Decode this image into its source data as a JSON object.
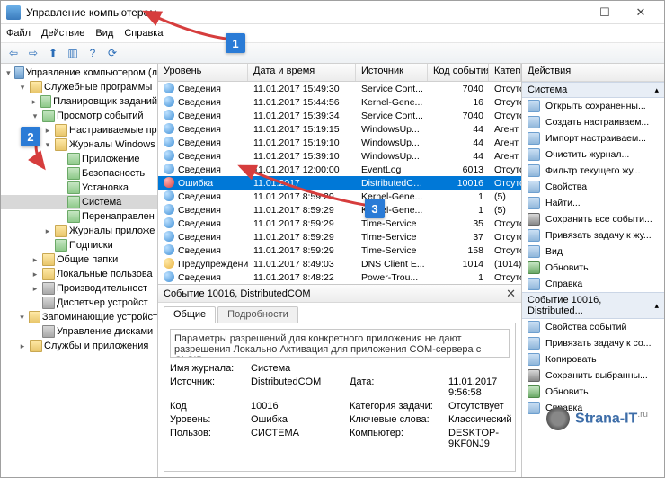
{
  "titlebar": {
    "title": "Управление компьютером"
  },
  "menubar": [
    "Файл",
    "Действие",
    "Вид",
    "Справка"
  ],
  "tree": {
    "root": "Управление компьютером (л",
    "items": [
      {
        "label": "Служебные программы",
        "depth": 1,
        "exp": "▾",
        "ico": "folder"
      },
      {
        "label": "Планировщик заданий",
        "depth": 2,
        "exp": "▸",
        "ico": "log"
      },
      {
        "label": "Просмотр событий",
        "depth": 2,
        "exp": "▾",
        "ico": "log"
      },
      {
        "label": "Настраиваемые пр",
        "depth": 3,
        "exp": "▸",
        "ico": "folder"
      },
      {
        "label": "Журналы Windows",
        "depth": 3,
        "exp": "▾",
        "ico": "folder"
      },
      {
        "label": "Приложение",
        "depth": 4,
        "exp": "",
        "ico": "log"
      },
      {
        "label": "Безопасность",
        "depth": 4,
        "exp": "",
        "ico": "log"
      },
      {
        "label": "Установка",
        "depth": 4,
        "exp": "",
        "ico": "log"
      },
      {
        "label": "Система",
        "depth": 4,
        "exp": "",
        "ico": "log",
        "sel": true
      },
      {
        "label": "Перенаправлен",
        "depth": 4,
        "exp": "",
        "ico": "log"
      },
      {
        "label": "Журналы приложе",
        "depth": 3,
        "exp": "▸",
        "ico": "folder"
      },
      {
        "label": "Подписки",
        "depth": 3,
        "exp": "",
        "ico": "log"
      },
      {
        "label": "Общие папки",
        "depth": 2,
        "exp": "▸",
        "ico": "folder"
      },
      {
        "label": "Локальные пользова",
        "depth": 2,
        "exp": "▸",
        "ico": "folder"
      },
      {
        "label": "Производительност",
        "depth": 2,
        "exp": "▸",
        "ico": "sys"
      },
      {
        "label": "Диспетчер устройст",
        "depth": 2,
        "exp": "",
        "ico": "sys"
      },
      {
        "label": "Запоминающие устройст",
        "depth": 1,
        "exp": "▾",
        "ico": "folder"
      },
      {
        "label": "Управление дисками",
        "depth": 2,
        "exp": "",
        "ico": "sys"
      },
      {
        "label": "Службы и приложения",
        "depth": 1,
        "exp": "▸",
        "ico": "folder"
      }
    ]
  },
  "grid": {
    "headers": {
      "level": "Уровень",
      "date": "Дата и время",
      "source": "Источник",
      "evt": "Код события",
      "cat": "Категория з..."
    },
    "rows": [
      {
        "lvl": "info",
        "level": "Сведения",
        "date": "11.01.2017 15:49:30",
        "src": "Service Cont...",
        "evt": "7040",
        "cat": "Отсутствует"
      },
      {
        "lvl": "info",
        "level": "Сведения",
        "date": "11.01.2017 15:44:56",
        "src": "Kernel-Gene...",
        "evt": "16",
        "cat": "Отсутствует"
      },
      {
        "lvl": "info",
        "level": "Сведения",
        "date": "11.01.2017 15:39:34",
        "src": "Service Cont...",
        "evt": "7040",
        "cat": "Отсутствует"
      },
      {
        "lvl": "info",
        "level": "Сведения",
        "date": "11.01.2017 15:19:15",
        "src": "WindowsUp...",
        "evt": "44",
        "cat": "Агент Центр..."
      },
      {
        "lvl": "info",
        "level": "Сведения",
        "date": "11.01.2017 15:19:10",
        "src": "WindowsUp...",
        "evt": "44",
        "cat": "Агент Центр..."
      },
      {
        "lvl": "info",
        "level": "Сведения",
        "date": "11.01.2017 15:39:10",
        "src": "WindowsUp...",
        "evt": "44",
        "cat": "Агент Центр..."
      },
      {
        "lvl": "info",
        "level": "Сведения",
        "date": "11.01.2017 12:00:00",
        "src": "EventLog",
        "evt": "6013",
        "cat": "Отсутствует"
      },
      {
        "lvl": "err",
        "level": "Ошибка",
        "date": "11.01.2017",
        "src": "DistributedC…",
        "evt": "10016",
        "cat": "Отсутствует",
        "sel": true
      },
      {
        "lvl": "info",
        "level": "Сведения",
        "date": "11.01.2017 8:59:29",
        "src": "Kernel-Gene...",
        "evt": "1",
        "cat": "(5)"
      },
      {
        "lvl": "info",
        "level": "Сведения",
        "date": "11.01.2017 8:59:29",
        "src": "Kernel-Gene...",
        "evt": "1",
        "cat": "(5)"
      },
      {
        "lvl": "info",
        "level": "Сведения",
        "date": "11.01.2017 8:59:29",
        "src": "Time-Service",
        "evt": "35",
        "cat": "Отсутствует"
      },
      {
        "lvl": "info",
        "level": "Сведения",
        "date": "11.01.2017 8:59:29",
        "src": "Time-Service",
        "evt": "37",
        "cat": "Отсутствует"
      },
      {
        "lvl": "info",
        "level": "Сведения",
        "date": "11.01.2017 8:59:29",
        "src": "Time-Service",
        "evt": "158",
        "cat": "Отсутствует"
      },
      {
        "lvl": "warn",
        "level": "Предупреждение",
        "date": "11.01.2017 8:49:03",
        "src": "DNS Client E...",
        "evt": "1014",
        "cat": "(1014)"
      },
      {
        "lvl": "info",
        "level": "Сведения",
        "date": "11.01.2017 8:48:22",
        "src": "Power-Trou...",
        "evt": "1",
        "cat": "Отсутствует"
      }
    ]
  },
  "detail": {
    "title": "Событие 10016, DistributedCOM",
    "tabs": {
      "general": "Общие",
      "details": "Подробности"
    },
    "message": "Параметры разрешений для конкретного приложения не дают разрешения Локально Активация для приложения COM-сервера с CLSID",
    "log_name_k": "Имя журнала:",
    "log_name_v": "Система",
    "source_k": "Источник:",
    "source_v": "DistributedCOM",
    "date_k": "Дата:",
    "date_v": "11.01.2017 9:56:58",
    "code_k": "Код",
    "code_v": "10016",
    "cat_k": "Категория задачи:",
    "cat_v": "Отсутствует",
    "level_k": "Уровень:",
    "level_v": "Ошибка",
    "keywords_k": "Ключевые слова:",
    "keywords_v": "Классический",
    "user_k": "Пользов:",
    "user_v": "СИСТЕМА",
    "computer_k": "Компьютер:",
    "computer_v": "DESKTOP-9KF0NJ9"
  },
  "actions": {
    "header": "Действия",
    "section1": "Система",
    "items1": [
      "Открыть сохраненны...",
      "Создать настраиваем...",
      "Импорт настраиваем...",
      "Очистить журнал...",
      "Фильтр текущего жу...",
      "Свойства",
      "Найти...",
      "Сохранить все событи...",
      "Привязать задачу к жу...",
      "Вид",
      "Обновить",
      "Справка"
    ],
    "section2": "Событие 10016, Distributed...",
    "items2": [
      "Свойства событий",
      "Привязать задачу к со...",
      "Копировать",
      "Сохранить выбранны...",
      "Обновить",
      "Справка"
    ]
  },
  "badges": {
    "b1": "1",
    "b2": "2",
    "b3": "3"
  },
  "watermark": {
    "text": "Strana-IT",
    "suffix": ".ru"
  }
}
